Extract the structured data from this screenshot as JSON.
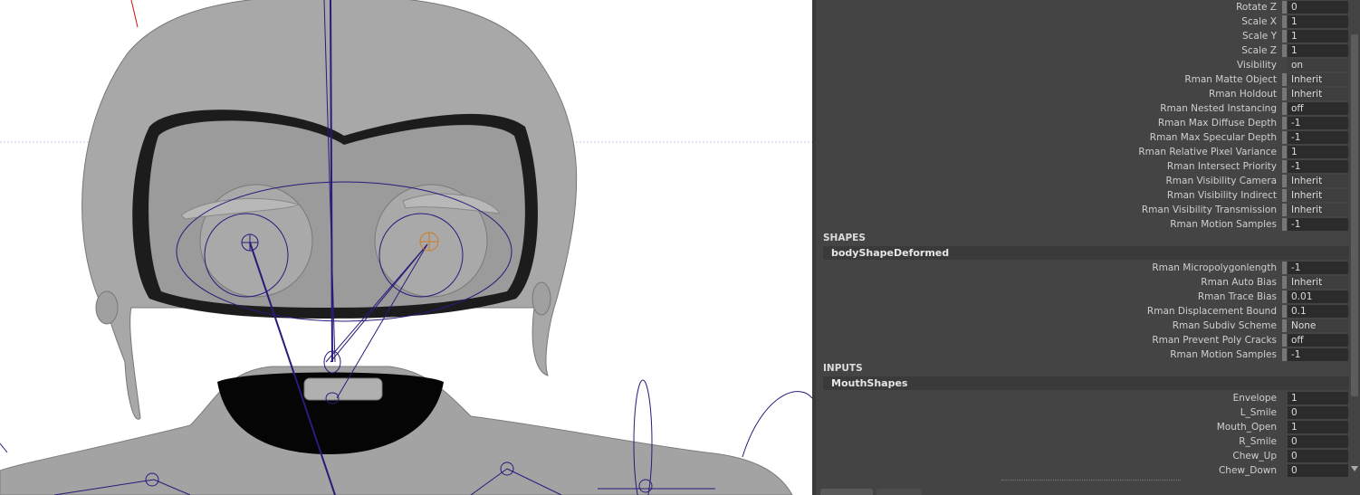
{
  "channel_box": {
    "transform_attrs": [
      {
        "label": "Rotate Z",
        "value": "0",
        "kind": "num"
      },
      {
        "label": "Scale X",
        "value": "1",
        "kind": "num"
      },
      {
        "label": "Scale Y",
        "value": "1",
        "kind": "num"
      },
      {
        "label": "Scale Z",
        "value": "1",
        "kind": "num"
      },
      {
        "label": "Visibility",
        "value": "on",
        "kind": "enum",
        "plain": true
      },
      {
        "label": "Rman Matte Object",
        "value": "Inherit",
        "kind": "enum"
      },
      {
        "label": "Rman Holdout",
        "value": "Inherit",
        "kind": "enum"
      },
      {
        "label": "Rman Nested Instancing",
        "value": "off",
        "kind": "num"
      },
      {
        "label": "Rman Max Diffuse Depth",
        "value": "-1",
        "kind": "num"
      },
      {
        "label": "Rman Max Specular Depth",
        "value": "-1",
        "kind": "num"
      },
      {
        "label": "Rman Relative Pixel Variance",
        "value": "1",
        "kind": "num"
      },
      {
        "label": "Rman Intersect Priority",
        "value": "-1",
        "kind": "num"
      },
      {
        "label": "Rman Visibility Camera",
        "value": "Inherit",
        "kind": "enum"
      },
      {
        "label": "Rman Visibility Indirect",
        "value": "Inherit",
        "kind": "enum"
      },
      {
        "label": "Rman Visibility Transmission",
        "value": "Inherit",
        "kind": "enum"
      },
      {
        "label": "Rman Motion Samples",
        "value": "-1",
        "kind": "num"
      }
    ],
    "shapes_header": "SHAPES",
    "shape_node": "bodyShapeDeformed",
    "shape_attrs": [
      {
        "label": "Rman Micropolygonlength",
        "value": "-1",
        "kind": "num"
      },
      {
        "label": "Rman Auto Bias",
        "value": "Inherit",
        "kind": "enum"
      },
      {
        "label": "Rman Trace Bias",
        "value": "0.01",
        "kind": "num"
      },
      {
        "label": "Rman Displacement Bound",
        "value": "0.1",
        "kind": "num"
      },
      {
        "label": "Rman Subdiv Scheme",
        "value": "None",
        "kind": "enum"
      },
      {
        "label": "Rman Prevent Poly Cracks",
        "value": "off",
        "kind": "num"
      },
      {
        "label": "Rman Motion Samples",
        "value": "-1",
        "kind": "num"
      }
    ],
    "inputs_header": "INPUTS",
    "input_node": "MouthShapes",
    "input_attrs": [
      {
        "label": "Envelope",
        "value": "1",
        "kind": "num",
        "plain": true
      },
      {
        "label": "L_Smile",
        "value": "0",
        "kind": "num",
        "plain": true
      },
      {
        "label": "Mouth_Open",
        "value": "1",
        "kind": "num",
        "plain": true
      },
      {
        "label": "R_Smile",
        "value": "0",
        "kind": "num",
        "plain": true
      },
      {
        "label": "Chew_Up",
        "value": "0",
        "kind": "num",
        "plain": true
      },
      {
        "label": "Chew_Down",
        "value": "0",
        "kind": "num",
        "plain": true
      }
    ]
  },
  "colors": {
    "panel_bg": "#444444",
    "field_bg": "#2b2b2b",
    "mesh_gray": "#a5a5a5",
    "rig_curve": "#2a1a7a",
    "selected_joint": "#d07a20"
  }
}
